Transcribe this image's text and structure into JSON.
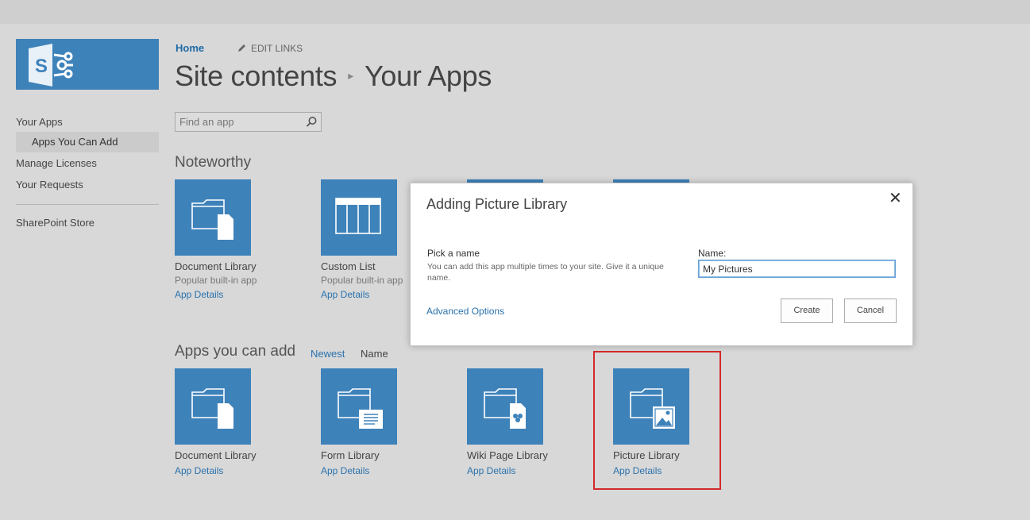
{
  "nav": {
    "home": "Home",
    "edit_links": "EDIT LINKS",
    "title_parent": "Site contents",
    "title_current": "Your Apps"
  },
  "leftnav": {
    "items": [
      "Your Apps",
      "Apps You Can Add",
      "Manage Licenses",
      "Your Requests",
      "SharePoint Store"
    ]
  },
  "search": {
    "placeholder": "Find an app"
  },
  "noteworthy": {
    "heading": "Noteworthy",
    "tiles": [
      {
        "name": "Document Library",
        "desc": "Popular built-in app",
        "link": "App Details",
        "icon": "document-library-icon"
      },
      {
        "name": "Custom List",
        "desc": "Popular built-in app",
        "link": "App Details",
        "icon": "custom-list-icon"
      }
    ]
  },
  "apps_you_can_add": {
    "heading": "Apps you can add",
    "sort_newest": "Newest",
    "sort_name": "Name",
    "tiles": [
      {
        "name": "Document Library",
        "link": "App Details",
        "icon": "document-library-icon"
      },
      {
        "name": "Form Library",
        "link": "App Details",
        "icon": "form-library-icon"
      },
      {
        "name": "Wiki Page Library",
        "link": "App Details",
        "icon": "wiki-page-library-icon"
      },
      {
        "name": "Picture Library",
        "link": "App Details",
        "icon": "picture-library-icon"
      }
    ]
  },
  "dialog": {
    "title": "Adding Picture Library",
    "close": "✕",
    "pick_label": "Pick a name",
    "pick_help": "You can add this app multiple times to your site. Give it a unique name.",
    "name_label": "Name:",
    "name_value": "My Pictures",
    "advanced": "Advanced Options",
    "create": "Create",
    "cancel": "Cancel"
  },
  "colors": {
    "tile_blue": "#3e82ba",
    "link_blue": "#2a72ad",
    "highlight_red": "#d42a2a"
  }
}
